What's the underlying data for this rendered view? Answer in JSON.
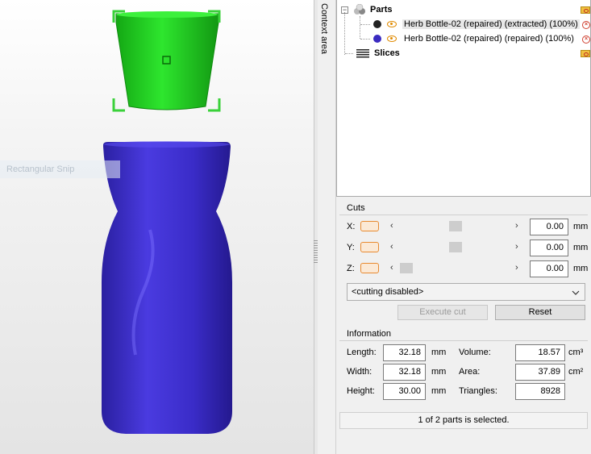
{
  "viewport": {
    "snip_overlay": "Rectangular Snip",
    "colors": {
      "selected_part": "#22cc22",
      "other_part": "#3a2bc0",
      "selection_handle": "#3ad13a"
    }
  },
  "context_area": {
    "label": "Context area"
  },
  "tree": {
    "parts_label": "Parts",
    "slices_label": "Slices",
    "items": [
      {
        "label": "Herb Bottle-02 (repaired) (extracted) (100%)",
        "dot_color": "#222222"
      },
      {
        "label": "Herb Bottle-02 (repaired) (repaired) (100%)",
        "dot_color": "#3a2bc0"
      }
    ]
  },
  "cuts": {
    "title": "Cuts",
    "rows": [
      {
        "axis": "X:",
        "value": "0.00",
        "unit": "mm",
        "position": 0.5
      },
      {
        "axis": "Y:",
        "value": "0.00",
        "unit": "mm",
        "position": 0.5
      },
      {
        "axis": "Z:",
        "value": "0.00",
        "unit": "mm",
        "position": 0.0
      }
    ],
    "mode": "<cutting disabled>",
    "execute_label": "Execute cut",
    "reset_label": "Reset"
  },
  "info": {
    "title": "Information",
    "length_label": "Length:",
    "length": "32.18",
    "length_unit": "mm",
    "width_label": "Width:",
    "width": "32.18",
    "width_unit": "mm",
    "height_label": "Height:",
    "height": "30.00",
    "height_unit": "mm",
    "volume_label": "Volume:",
    "volume": "18.57",
    "volume_unit": "cm³",
    "area_label": "Area:",
    "area": "37.89",
    "area_unit": "cm²",
    "triangles_label": "Triangles:",
    "triangles": "8928"
  },
  "status": "1 of 2 parts is selected."
}
